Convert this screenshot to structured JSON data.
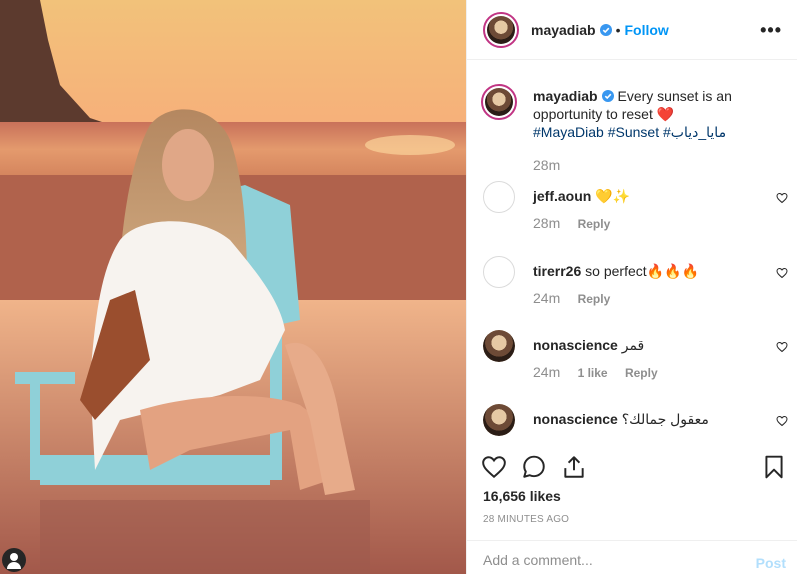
{
  "post": {
    "username": "mayadiab",
    "separator": "•",
    "follow_label": "Follow",
    "more_label": "•••"
  },
  "caption": {
    "username": "mayadiab",
    "text_part1": "Every sunset is an opportunity to reset",
    "heart_emoji": "❤️",
    "hashtag1": "#MayaDiab",
    "hashtag2": "#Sunset",
    "hashtag3": "#مايا_دياب",
    "time": "28m"
  },
  "comments": [
    {
      "username": "jeff.aoun",
      "text": "💛✨",
      "time": "28m",
      "likes": "",
      "reply_label": "Reply"
    },
    {
      "username": "tirerr26",
      "text": "so perfect🔥🔥🔥",
      "time": "24m",
      "likes": "",
      "reply_label": "Reply"
    },
    {
      "username": "nonascience",
      "text": "قمر",
      "time": "24m",
      "likes": "1 like",
      "reply_label": "Reply"
    },
    {
      "username": "nonascience",
      "text": "معقول جمالك؟",
      "time": "",
      "likes": "",
      "reply_label": ""
    }
  ],
  "likes_text": "16,656 likes",
  "time_ago": "28 MINUTES AGO",
  "add_comment": {
    "placeholder": "Add a comment...",
    "post_label": "Post"
  },
  "colors": {
    "accent": "#0095f6",
    "verified": "#3897f0",
    "hashtag": "#00376b",
    "muted": "#8e8e8e",
    "post_disabled": "#b2dffc",
    "like_heart": "#ed4956"
  },
  "icons": [
    "verified-badge-icon",
    "more-options-icon",
    "heart-icon",
    "comment-icon",
    "share-icon",
    "bookmark-icon",
    "user-icon"
  ]
}
